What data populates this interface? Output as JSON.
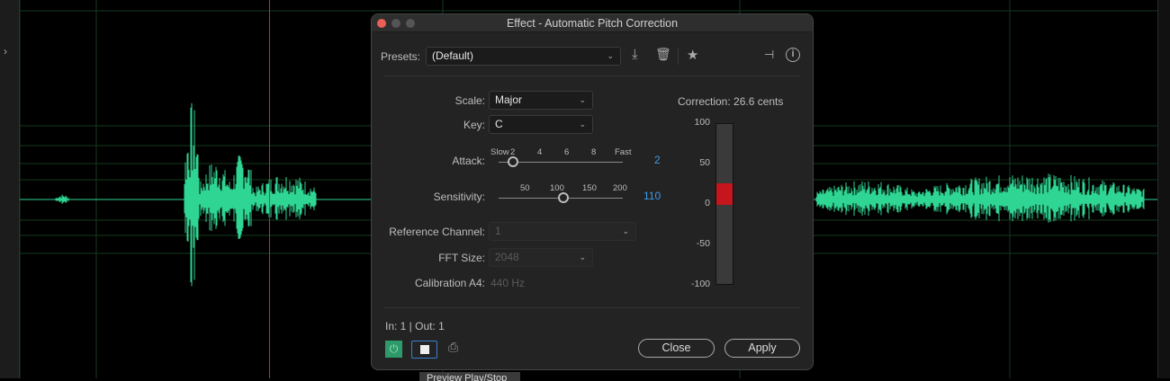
{
  "dialog": {
    "title": "Effect - Automatic Pitch Correction",
    "presets_label": "Presets:",
    "preset_value": "(Default)",
    "scale_label": "Scale:",
    "scale_value": "Major",
    "key_label": "Key:",
    "key_value": "C",
    "attack_label": "Attack:",
    "attack_ticks": [
      "Slow",
      "2",
      "4",
      "6",
      "8",
      "Fast"
    ],
    "attack_value": "2",
    "sensitivity_label": "Sensitivity:",
    "sensitivity_ticks": [
      "50",
      "100",
      "150",
      "200"
    ],
    "sensitivity_value": "110",
    "ref_channel_label": "Reference Channel:",
    "ref_channel_value": "1",
    "fft_label": "FFT Size:",
    "fft_value": "2048",
    "calibration_label": "Calibration A4:",
    "calibration_value": "440 Hz",
    "correction_text": "Correction:  26.6 cents",
    "meter_ticks": [
      "100",
      "50",
      "0",
      "-50",
      "-100"
    ],
    "meter_value": 26.6,
    "io_text": "In: 1 | Out: 1",
    "close_label": "Close",
    "apply_label": "Apply"
  },
  "tooltip": "Preview Play/Stop",
  "colors": {
    "waveform": "#2fd592",
    "playhead": "#e0232a",
    "power": "#2e9a6a",
    "meter_fill": "#c4161c",
    "accent": "#3d9ae8"
  }
}
